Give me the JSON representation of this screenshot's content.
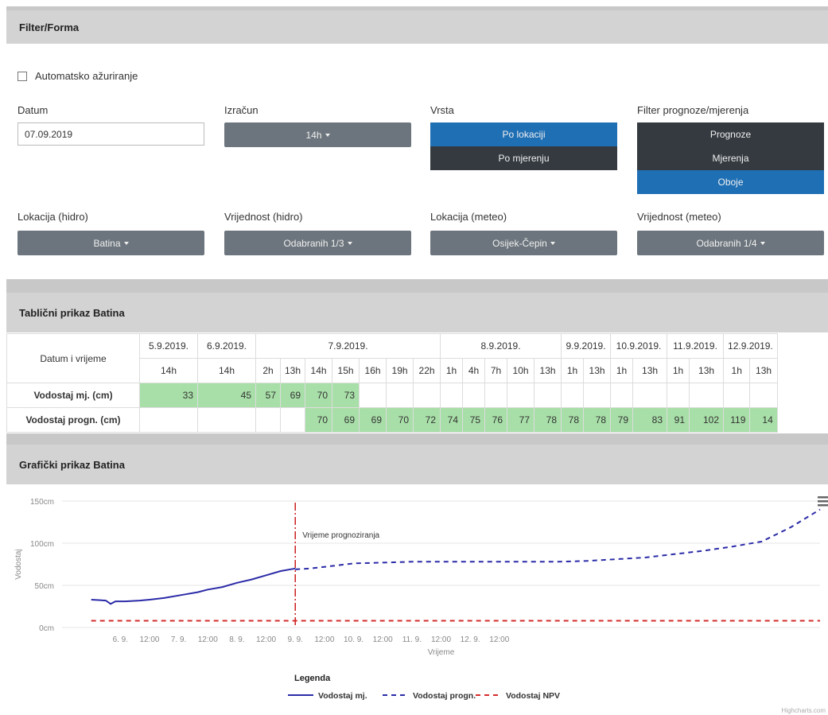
{
  "filter": {
    "title": "Filter/Forma",
    "auto_update_label": "Automatsko ažuriranje",
    "datum_label": "Datum",
    "datum_value": "07.09.2019",
    "izracun_label": "Izračun",
    "izracun_value": "14h",
    "vrsta_label": "Vrsta",
    "vrsta_options": [
      "Po lokaciji",
      "Po mjerenju"
    ],
    "vrsta_selected": "Po lokaciji",
    "filter_label": "Filter prognoze/mjerenja",
    "filter_options": [
      "Prognoze",
      "Mjerenja",
      "Oboje"
    ],
    "filter_selected": "Oboje",
    "lok_hidro_label": "Lokacija (hidro)",
    "lok_hidro_value": "Batina",
    "vrij_hidro_label": "Vrijednost (hidro)",
    "vrij_hidro_value": "Odabranih 1/3",
    "lok_meteo_label": "Lokacija (meteo)",
    "lok_meteo_value": "Osijek-Čepin",
    "vrij_meteo_label": "Vrijednost (meteo)",
    "vrij_meteo_value": "Odabranih 1/4"
  },
  "table": {
    "title": "Tablični prikaz Batina",
    "corner_label": "Datum i vrijeme",
    "dates": [
      "5.9.2019.",
      "6.9.2019.",
      "7.9.2019.",
      "8.9.2019.",
      "9.9.2019.",
      "10.9.2019.",
      "11.9.2019.",
      "12.9.2019."
    ],
    "hours": [
      "14h",
      "14h",
      "2h",
      "13h",
      "14h",
      "15h",
      "16h",
      "19h",
      "22h",
      "1h",
      "4h",
      "7h",
      "10h",
      "13h",
      "1h",
      "13h",
      "1h",
      "13h",
      "1h",
      "13h",
      "1h",
      "13h"
    ],
    "row1_label": "Vodostaj mj. (cm)",
    "row1": [
      "33",
      "45",
      "57",
      "69",
      "70",
      "73",
      "",
      "",
      "",
      "",
      "",
      "",
      "",
      "",
      "",
      "",
      "",
      "",
      "",
      "",
      "",
      ""
    ],
    "row2_label": "Vodostaj progn. (cm)",
    "row2": [
      "",
      "",
      "",
      "",
      "70",
      "69",
      "69",
      "70",
      "72",
      "74",
      "75",
      "76",
      "77",
      "78",
      "78",
      "78",
      "79",
      "83",
      "91",
      "102",
      "119",
      "14"
    ]
  },
  "chart": {
    "title": "Grafički prikaz Batina",
    "menu_icon": "hamburger-icon",
    "credit": "Highcharts.com",
    "annotation": "Vrijeme prognoziranja",
    "legend_title": "Legenda",
    "colors": {
      "measured": "#2b2ba8",
      "forecast": "#2b2ba8",
      "npv": "#d42b2b",
      "marker": "#cc1f1f"
    }
  },
  "chart_data": {
    "type": "line",
    "ylabel": "Vodostaj",
    "xlabel": "Vrijeme",
    "ylim": [
      0,
      150
    ],
    "y_ticks": [
      "0cm",
      "50cm",
      "100cm",
      "150cm"
    ],
    "x_ticks": [
      "6. 9.",
      "12:00",
      "7. 9.",
      "12:00",
      "8. 9.",
      "12:00",
      "9. 9.",
      "12:00",
      "10. 9.",
      "12:00",
      "11. 9.",
      "12:00",
      "12. 9.",
      "12:00"
    ],
    "forecast_time_hours": 84,
    "series": [
      {
        "name": "Vodostaj mj.",
        "style": "solid",
        "x": [
          0,
          6,
          8,
          10,
          14,
          20,
          24,
          30,
          38,
          44,
          48,
          54,
          60,
          66,
          72,
          78,
          84
        ],
        "y": [
          33,
          32,
          28,
          31,
          31,
          32,
          33,
          35,
          39,
          42,
          45,
          48,
          53,
          57,
          62,
          67,
          70
        ]
      },
      {
        "name": "Vodostaj progn.",
        "style": "dashed",
        "x": [
          84,
          90,
          96,
          102,
          108,
          120,
          132,
          144,
          156,
          168,
          180,
          192,
          204,
          216,
          228,
          240,
          252,
          264,
          276,
          288,
          300
        ],
        "y": [
          69,
          70,
          72,
          74,
          76,
          77,
          78,
          78,
          78,
          78,
          78,
          78,
          79,
          81,
          83,
          87,
          91,
          96,
          102,
          119,
          140
        ]
      },
      {
        "name": "Vodostaj NPV",
        "style": "dashed",
        "x": [
          0,
          300
        ],
        "y": [
          8,
          8
        ]
      }
    ]
  }
}
